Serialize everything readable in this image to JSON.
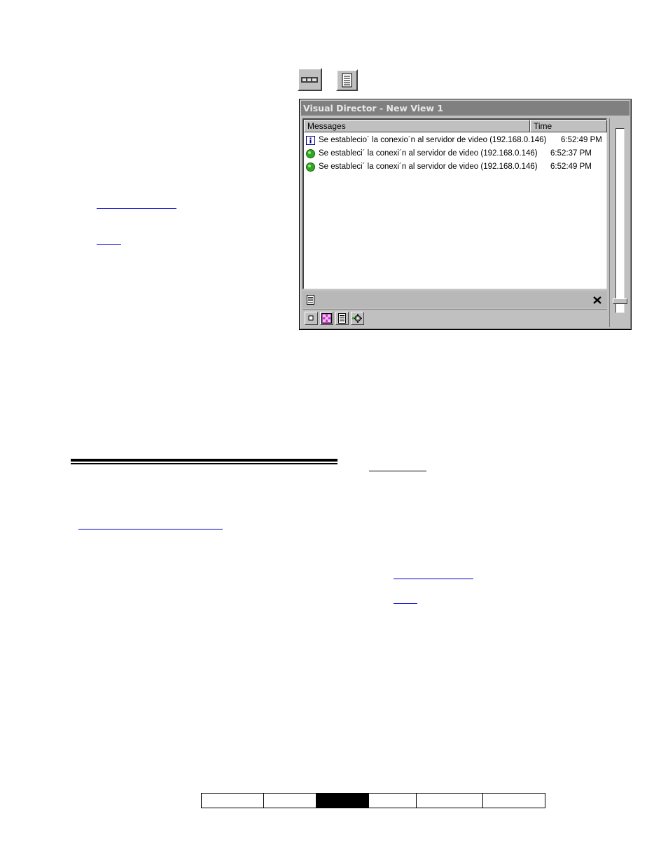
{
  "toolbar_icons": [
    {
      "icon": "view-strip-icon"
    },
    {
      "icon": "message-log-icon"
    }
  ],
  "window": {
    "title": "Visual Director - New View 1",
    "columns": {
      "messages": "Messages",
      "time": "Time"
    },
    "rows": [
      {
        "icon": "info-icon",
        "message": "Se establecio´ la conexio´n al servidor de video (192.168.0.146)",
        "time": "6:52:49 PM"
      },
      {
        "icon": "green-status-icon",
        "message": "Se estableci´ la conexi´n al servidor de video (192.168.0.146)",
        "time": "6:52:37 PM"
      },
      {
        "icon": "green-status-icon",
        "message": "Se estableci´ la conexi´n al servidor de video (192.168.0.146)",
        "time": "6:52:49 PM"
      }
    ],
    "status_icons": [
      "message-log-icon",
      "close-icon"
    ],
    "bottom_buttons": [
      {
        "icon": "single-view-icon"
      },
      {
        "icon": "grid-view-icon"
      },
      {
        "icon": "message-log-icon"
      },
      {
        "icon": "camera-settings-icon"
      }
    ]
  },
  "footer_nav": {
    "cells": [
      "",
      "",
      "",
      "",
      "",
      ""
    ],
    "active_index": 2
  },
  "colors": {
    "window_face": "#c0c0c0",
    "titlebar": "#808080",
    "title_text": "#e8e8e8",
    "link": "#0000cc",
    "status_green": "#2faa1f"
  }
}
